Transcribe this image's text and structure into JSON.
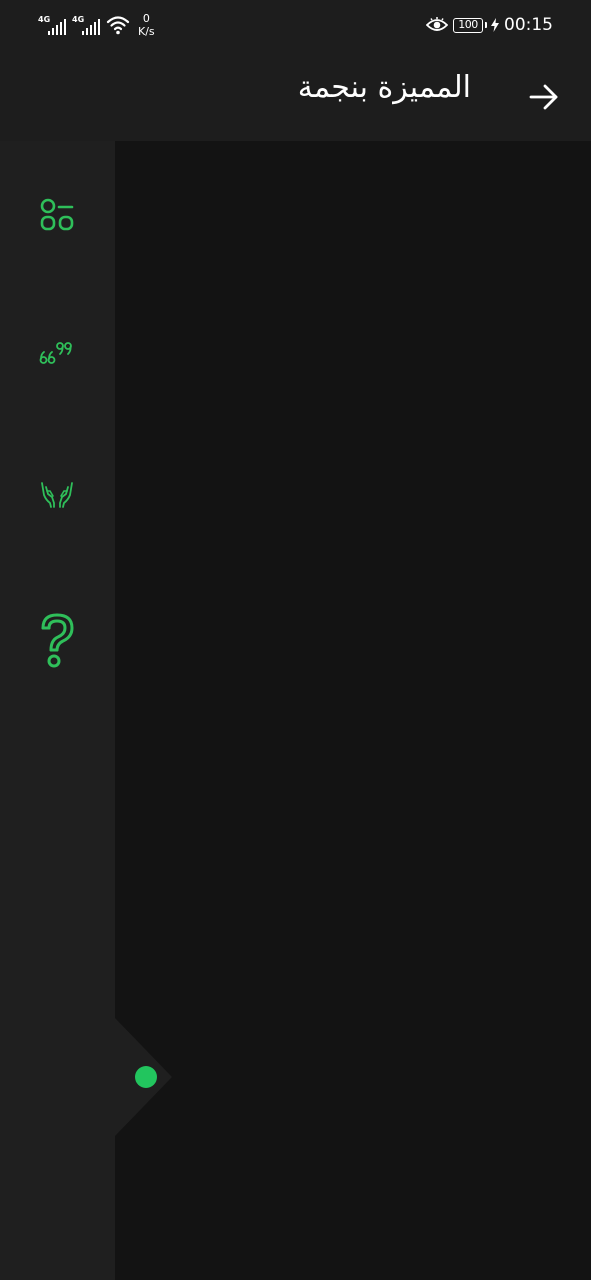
{
  "status_bar": {
    "network_1": "4G",
    "network_2": "4G",
    "speed_value": "0",
    "speed_unit": "K/s",
    "battery": "100",
    "time": "00:15"
  },
  "app_bar": {
    "title": "المميزة بنجمة",
    "back_icon": "arrow-right-icon"
  },
  "side_panel": {
    "items": [
      {
        "name": "categories",
        "icon": "grid-apps-icon"
      },
      {
        "name": "quotes",
        "icon": "quote-icon"
      },
      {
        "name": "prayer",
        "icon": "praying-hands-icon"
      },
      {
        "name": "questions",
        "icon": "question-mark-icon"
      }
    ]
  },
  "colors": {
    "accent": "#2fbf5a",
    "handle_dot": "#22c55e",
    "bar_bg": "#1d1d1d",
    "panel_bg": "#1f1f1f",
    "content_bg": "#131313"
  }
}
